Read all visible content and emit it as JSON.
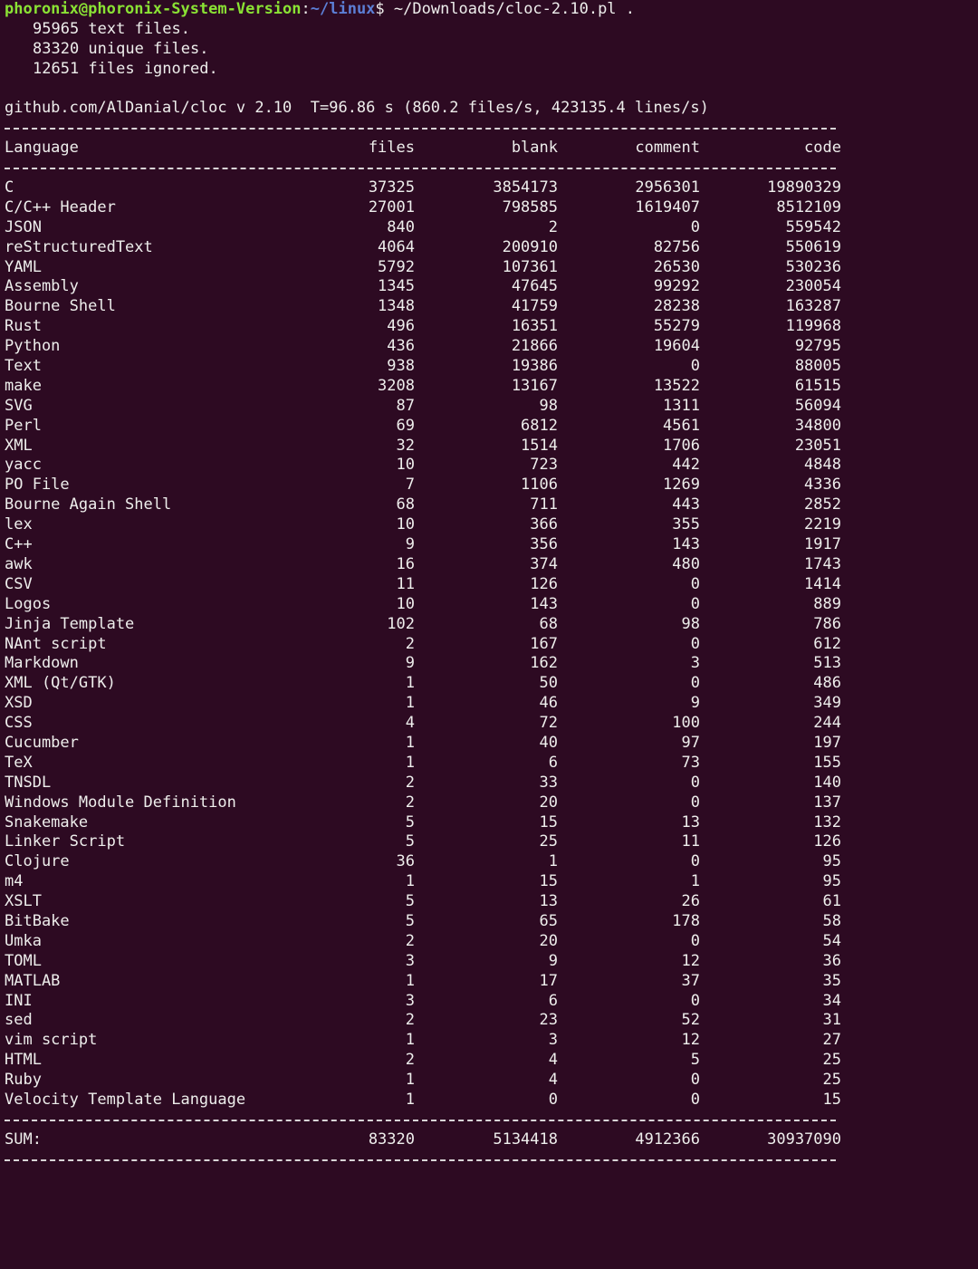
{
  "terminal": {
    "prompt_user_host": "phoronix@phoronix-System-Version",
    "prompt_colon": ":",
    "prompt_path": "~/linux",
    "prompt_dollar": "$",
    "command": " ~/Downloads/cloc-2.10.pl ."
  },
  "output": {
    "text_files": "95965 text files.",
    "unique_files": "83320 unique files.",
    "files_ignored": "12651 files ignored.",
    "header_line": "github.com/AlDanial/cloc v 2.10  T=96.86 s (860.2 files/s, 423135.4 lines/s)"
  },
  "table": {
    "columns": [
      "Language",
      "files",
      "blank",
      "comment",
      "code"
    ],
    "rows": [
      [
        "C",
        "37325",
        "3854173",
        "2956301",
        "19890329"
      ],
      [
        "C/C++ Header",
        "27001",
        "798585",
        "1619407",
        "8512109"
      ],
      [
        "JSON",
        "840",
        "2",
        "0",
        "559542"
      ],
      [
        "reStructuredText",
        "4064",
        "200910",
        "82756",
        "550619"
      ],
      [
        "YAML",
        "5792",
        "107361",
        "26530",
        "530236"
      ],
      [
        "Assembly",
        "1345",
        "47645",
        "99292",
        "230054"
      ],
      [
        "Bourne Shell",
        "1348",
        "41759",
        "28238",
        "163287"
      ],
      [
        "Rust",
        "496",
        "16351",
        "55279",
        "119968"
      ],
      [
        "Python",
        "436",
        "21866",
        "19604",
        "92795"
      ],
      [
        "Text",
        "938",
        "19386",
        "0",
        "88005"
      ],
      [
        "make",
        "3208",
        "13167",
        "13522",
        "61515"
      ],
      [
        "SVG",
        "87",
        "98",
        "1311",
        "56094"
      ],
      [
        "Perl",
        "69",
        "6812",
        "4561",
        "34800"
      ],
      [
        "XML",
        "32",
        "1514",
        "1706",
        "23051"
      ],
      [
        "yacc",
        "10",
        "723",
        "442",
        "4848"
      ],
      [
        "PO File",
        "7",
        "1106",
        "1269",
        "4336"
      ],
      [
        "Bourne Again Shell",
        "68",
        "711",
        "443",
        "2852"
      ],
      [
        "lex",
        "10",
        "366",
        "355",
        "2219"
      ],
      [
        "C++",
        "9",
        "356",
        "143",
        "1917"
      ],
      [
        "awk",
        "16",
        "374",
        "480",
        "1743"
      ],
      [
        "CSV",
        "11",
        "126",
        "0",
        "1414"
      ],
      [
        "Logos",
        "10",
        "143",
        "0",
        "889"
      ],
      [
        "Jinja Template",
        "102",
        "68",
        "98",
        "786"
      ],
      [
        "NAnt script",
        "2",
        "167",
        "0",
        "612"
      ],
      [
        "Markdown",
        "9",
        "162",
        "3",
        "513"
      ],
      [
        "XML (Qt/GTK)",
        "1",
        "50",
        "0",
        "486"
      ],
      [
        "XSD",
        "1",
        "46",
        "9",
        "349"
      ],
      [
        "CSS",
        "4",
        "72",
        "100",
        "244"
      ],
      [
        "Cucumber",
        "1",
        "40",
        "97",
        "197"
      ],
      [
        "TeX",
        "1",
        "6",
        "73",
        "155"
      ],
      [
        "TNSDL",
        "2",
        "33",
        "0",
        "140"
      ],
      [
        "Windows Module Definition",
        "2",
        "20",
        "0",
        "137"
      ],
      [
        "Snakemake",
        "5",
        "15",
        "13",
        "132"
      ],
      [
        "Linker Script",
        "5",
        "25",
        "11",
        "126"
      ],
      [
        "Clojure",
        "36",
        "1",
        "0",
        "95"
      ],
      [
        "m4",
        "1",
        "15",
        "1",
        "95"
      ],
      [
        "XSLT",
        "5",
        "13",
        "26",
        "61"
      ],
      [
        "BitBake",
        "5",
        "65",
        "178",
        "58"
      ],
      [
        "Umka",
        "2",
        "20",
        "0",
        "54"
      ],
      [
        "TOML",
        "3",
        "9",
        "12",
        "36"
      ],
      [
        "MATLAB",
        "1",
        "17",
        "37",
        "35"
      ],
      [
        "INI",
        "3",
        "6",
        "0",
        "34"
      ],
      [
        "sed",
        "2",
        "23",
        "52",
        "31"
      ],
      [
        "vim script",
        "1",
        "3",
        "12",
        "27"
      ],
      [
        "HTML",
        "2",
        "4",
        "5",
        "25"
      ],
      [
        "Ruby",
        "1",
        "4",
        "0",
        "25"
      ],
      [
        "Velocity Template Language",
        "1",
        "0",
        "0",
        "15"
      ]
    ],
    "sum": [
      "SUM:",
      "83320",
      "5134418",
      "4912366",
      "30937090"
    ]
  },
  "colors": {
    "background": "#2d0a22",
    "text": "#eeeeec",
    "prompt_user": "#8ae234",
    "prompt_path": "#5c7fd6"
  }
}
